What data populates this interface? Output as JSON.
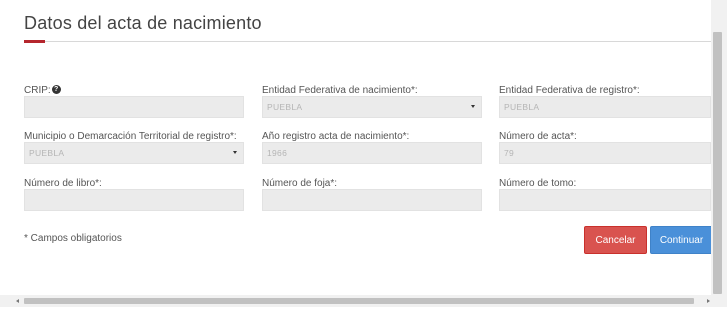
{
  "header": {
    "title": "Datos del acta de nacimiento"
  },
  "fields": [
    {
      "label": "CRIP:",
      "value": ""
    },
    {
      "label": "Entidad Federativa de nacimiento*:",
      "value": "PUEBLA"
    },
    {
      "label": "Entidad Federativa de registro*:",
      "value": "PUEBLA"
    },
    {
      "label": "Municipio o Demarcación Territorial de registro*:",
      "value": "PUEBLA"
    },
    {
      "label": "Año registro acta de nacimiento*:",
      "value": "1966"
    },
    {
      "label": "Número de acta*:",
      "value": "79"
    },
    {
      "label": "Número de libro*:",
      "value": ""
    },
    {
      "label": "Número de foja*:",
      "value": ""
    },
    {
      "label": "Número de tomo:",
      "value": ""
    }
  ],
  "info_icon": {
    "name": "info-icon",
    "glyph": "?"
  },
  "footer": {
    "required_note": "* Campos obligatorios",
    "cancel_label": "Cancelar",
    "continue_label": "Continuar"
  },
  "colors": {
    "accent": "#b5262d",
    "cancel": "#d9534f",
    "continue": "#4a90d9"
  }
}
